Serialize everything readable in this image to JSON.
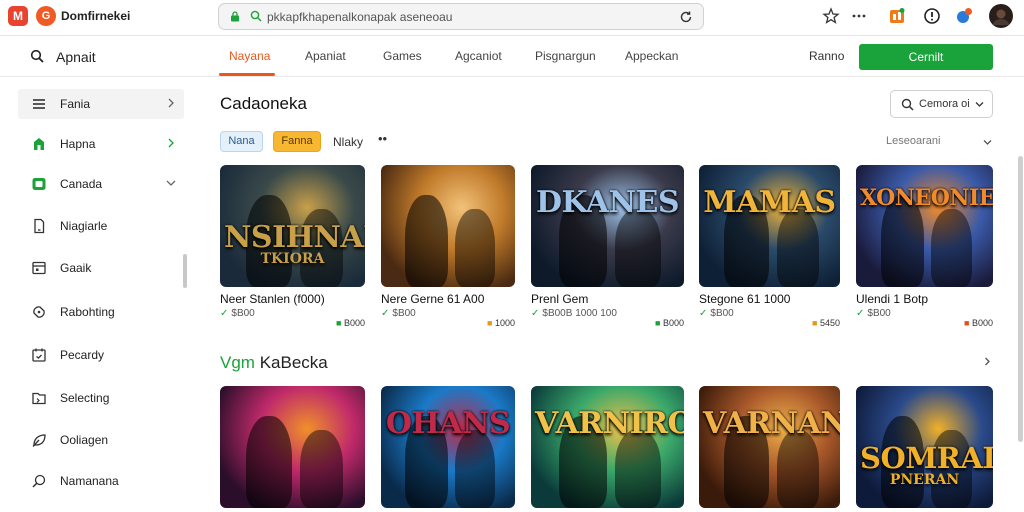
{
  "browser": {
    "logo_left": "M",
    "logo_right": "G",
    "brand": "Domfirnekei",
    "url": "pkkapfkhapenalkonapak aseneoau",
    "icons": [
      "lock-icon",
      "search-icon",
      "reload-icon",
      "star-icon",
      "more-icon",
      "extension-icon",
      "download-icon",
      "notification-icon",
      "avatar"
    ]
  },
  "nav": {
    "title": "Apnait",
    "tabs": [
      "Nayana",
      "Apaniat",
      "Games",
      "Agcaniot",
      "Pisgnargun",
      "Appeckan"
    ],
    "active_tab": 0,
    "rank_label": "Ranno",
    "cta_label": "Cernilt"
  },
  "sidebar": {
    "items": [
      {
        "label": "Fania",
        "icon": "menu-icon",
        "chevron": true
      },
      {
        "label": "Hapna",
        "icon": "store-icon",
        "chevron": true
      },
      {
        "label": "Canada",
        "icon": "gamepad-icon",
        "chevron": true
      },
      {
        "label": "Niagiarle",
        "icon": "phone-icon"
      },
      {
        "label": "Gaaik",
        "icon": "grid-icon"
      },
      {
        "label": "Rabohting",
        "icon": "puzzle-icon"
      },
      {
        "label": "Pecardy",
        "icon": "calendar-icon"
      },
      {
        "label": "Selecting",
        "icon": "folder-icon"
      },
      {
        "label": "Ooliagen",
        "icon": "leaf-icon"
      },
      {
        "label": "Namanana",
        "icon": "search-icon"
      }
    ]
  },
  "main": {
    "title": "Cadaoneka",
    "sort_label": "Cemora oi",
    "chips": [
      "Nana",
      "Fanna"
    ],
    "filter_label": "Nlaky",
    "filter_more": "••",
    "filter_right": "Leseoarani",
    "section2_green": "Vgm",
    "section2_rest": "KaBecka"
  },
  "games": [
    {
      "title": "Neer Stanlen (f000)",
      "price": "$B00",
      "badge": "B000",
      "badge_color": "#1aa33a",
      "art": {
        "main": "NSIHNAK",
        "sub": "TKIORA",
        "palette": [
          "#1a2a3a",
          "#3a4a4a",
          "#c8a04a"
        ]
      }
    },
    {
      "title": "Nere Gerne 61 A00",
      "price": "$B00",
      "badge": "1000",
      "badge_color": "#e09a1a",
      "art": {
        "main": "",
        "sub": "",
        "palette": [
          "#4a2a12",
          "#c07a2a",
          "#f2c27a"
        ]
      }
    },
    {
      "title": "Prenl Gem",
      "price": "$B00B 1000 100",
      "badge": "B000",
      "badge_color": "#1aa33a",
      "art": {
        "main": "DKANES",
        "sub": "",
        "palette": [
          "#0e1a2a",
          "#3a3a4a",
          "#9ec2e8"
        ]
      }
    },
    {
      "title": "Stegone 61 1000",
      "price": "$B00",
      "badge": "5450",
      "badge_color": "#e09a1a",
      "art": {
        "main": "MAMAS",
        "sub": "",
        "palette": [
          "#0e2036",
          "#2a4a6a",
          "#f0b43a"
        ]
      }
    },
    {
      "title": "Ulendi 1 Botp",
      "price": "$B00",
      "badge": "B000",
      "badge_color": "#e0501a",
      "art": {
        "main": "XONEONIEE",
        "sub": "",
        "palette": [
          "#1a1a3a",
          "#3a5aa8",
          "#f08a2a"
        ]
      }
    },
    {
      "title": "",
      "price": "",
      "badge": "",
      "badge_color": "#1aa33a",
      "art": {
        "main": "",
        "sub": "",
        "palette": [
          "#2a0e2a",
          "#c02a6a",
          "#f0902a"
        ]
      }
    },
    {
      "title": "",
      "price": "",
      "badge": "",
      "badge_color": "#1aa33a",
      "art": {
        "main": "OHANS",
        "sub": "",
        "palette": [
          "#0a2a4a",
          "#1a7ac8",
          "#c02a4a"
        ]
      }
    },
    {
      "title": "",
      "price": "",
      "badge": "",
      "badge_color": "#1aa33a",
      "art": {
        "main": "VARNIRO",
        "sub": "",
        "palette": [
          "#0a3a3a",
          "#3aa86a",
          "#f0c24a"
        ]
      }
    },
    {
      "title": "",
      "price": "",
      "badge": "",
      "badge_color": "#1aa33a",
      "art": {
        "main": "VARNANS",
        "sub": "",
        "palette": [
          "#3a1a0a",
          "#a8582a",
          "#f0b04a"
        ]
      }
    },
    {
      "title": "",
      "price": "",
      "badge": "",
      "badge_color": "#1aa33a",
      "art": {
        "main": "SOMRAIN",
        "sub": "PNERAN",
        "palette": [
          "#0e1a3a",
          "#2a4a8a",
          "#f0b02a"
        ]
      }
    }
  ]
}
